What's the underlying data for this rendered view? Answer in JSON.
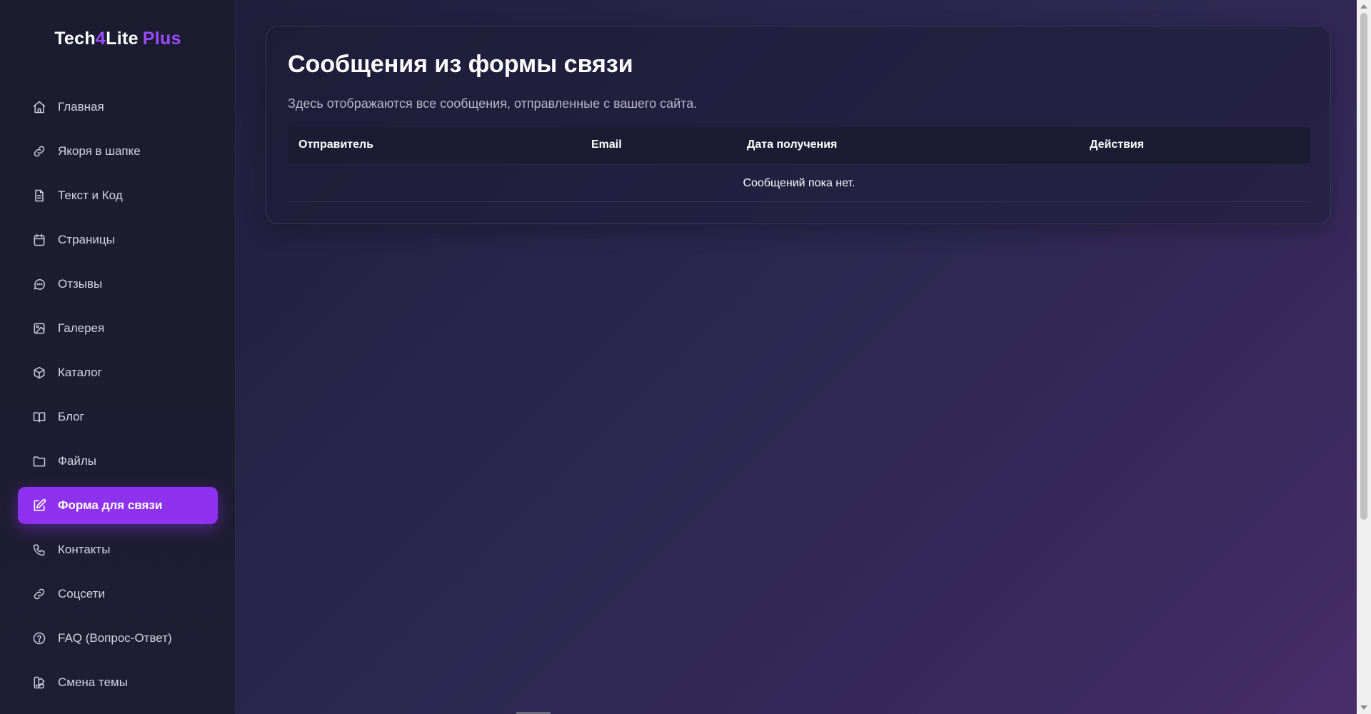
{
  "brand": {
    "part1": "Tech",
    "part2": "4",
    "part3": "Lite",
    "part4": "Plus",
    "accent": "#9b4dff"
  },
  "sidebar": {
    "items": [
      {
        "label": "Главная",
        "icon": "home-icon"
      },
      {
        "label": "Якоря в шапке",
        "icon": "link-icon"
      },
      {
        "label": "Текст и Код",
        "icon": "document-icon"
      },
      {
        "label": "Страницы",
        "icon": "calendar-icon"
      },
      {
        "label": "Отзывы",
        "icon": "chat-bubble-icon"
      },
      {
        "label": "Галерея",
        "icon": "image-icon"
      },
      {
        "label": "Каталог",
        "icon": "box-icon"
      },
      {
        "label": "Блог",
        "icon": "book-icon"
      },
      {
        "label": "Файлы",
        "icon": "folder-icon"
      },
      {
        "label": "Форма для связи",
        "icon": "edit-icon",
        "active": true
      },
      {
        "label": "Контакты",
        "icon": "phone-icon"
      },
      {
        "label": "Соцсети",
        "icon": "link-icon"
      },
      {
        "label": "FAQ (Вопрос-Ответ)",
        "icon": "question-circle-icon"
      },
      {
        "label": "Смена темы",
        "icon": "palette-icon"
      }
    ],
    "active_color": "#8e32f0"
  },
  "main": {
    "title": "Сообщения из формы связи",
    "subtitle": "Здесь отображаются все сообщения, отправленные с вашего сайта.",
    "table": {
      "columns": [
        "Отправитель",
        "Email",
        "Дата получения",
        "Действия"
      ],
      "empty_text": "Сообщений пока нет."
    }
  }
}
